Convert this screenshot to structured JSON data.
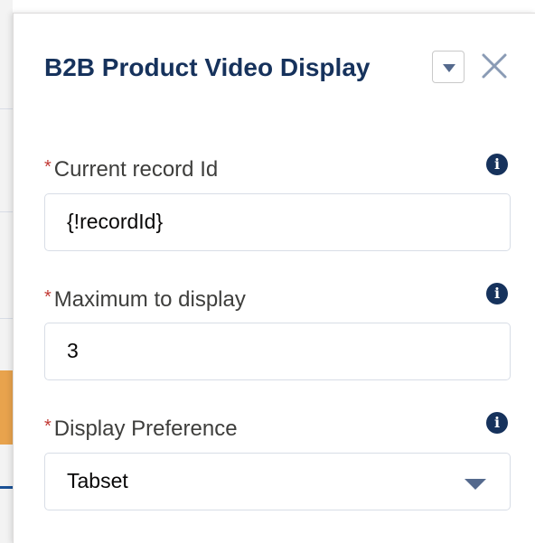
{
  "panel": {
    "title": "B2B Product Video Display",
    "menu_icon": "chevron-down-icon",
    "close_icon": "close-icon"
  },
  "fields": [
    {
      "required_mark": "*",
      "label": "Current record Id",
      "info_icon": "info-icon",
      "value": "{!recordId}"
    },
    {
      "required_mark": "*",
      "label": "Maximum to display",
      "info_icon": "info-icon",
      "value": "3"
    },
    {
      "required_mark": "*",
      "label": "Display Preference",
      "info_icon": "info-icon",
      "value": "Tabset"
    }
  ],
  "colors": {
    "title": "#16325c",
    "required": "#c23934",
    "label": "#3e3e3c",
    "input_border": "#d8dde6",
    "icon": "#54698d"
  }
}
